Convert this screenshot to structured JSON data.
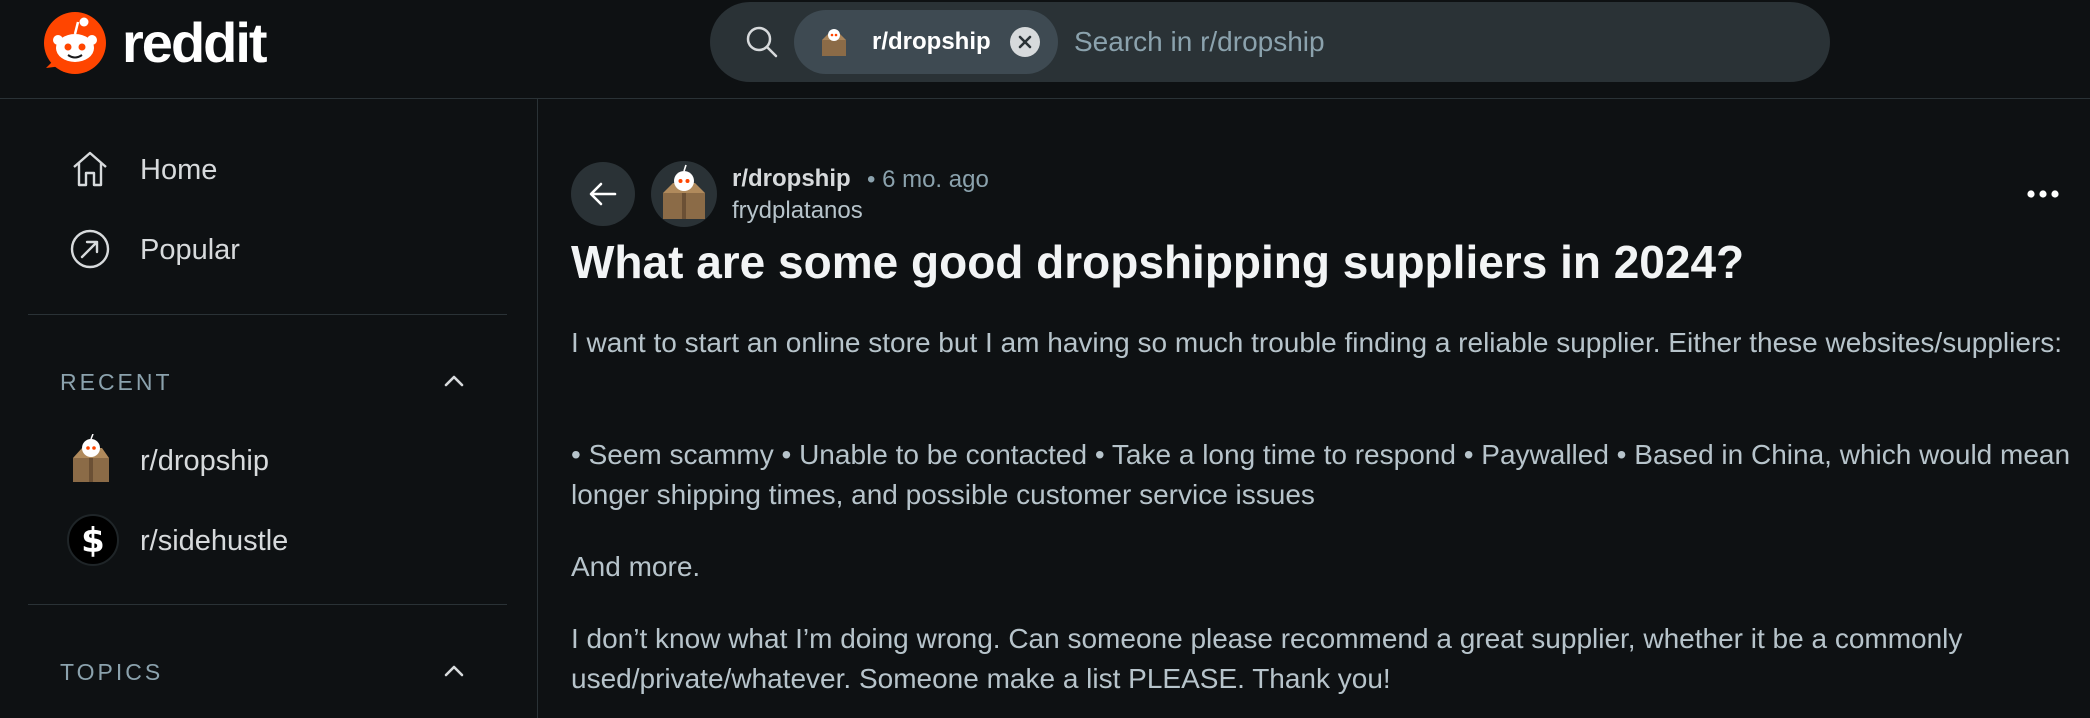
{
  "header": {
    "logo_text": "reddit",
    "search": {
      "chip_label": "r/dropship",
      "placeholder": "Search in r/dropship"
    }
  },
  "sidebar": {
    "nav": [
      {
        "label": "Home",
        "icon": "home-icon"
      },
      {
        "label": "Popular",
        "icon": "popular-icon"
      }
    ],
    "recent": {
      "heading": "RECENT",
      "items": [
        {
          "label": "r/dropship",
          "icon": "dropship-avatar"
        },
        {
          "label": "r/sidehustle",
          "icon": "sidehustle-avatar"
        }
      ]
    },
    "topics": {
      "heading": "TOPICS"
    }
  },
  "post": {
    "subreddit": "r/dropship",
    "time": "• 6 mo. ago",
    "author": "frydplatanos",
    "title": "What are some good dropshipping suppliers in 2024?",
    "paragraphs": [
      "I want to start an online store but I am having so much trouble finding a reliable supplier. Either these websites/suppliers:",
      "• Seem scammy • Unable to be contacted • Take a long time to respond • Paywalled • Based in China, which would mean longer shipping times, and possible customer service issues",
      "And more.",
      "I don’t know what I’m doing wrong. Can someone please recommend a great supplier, whether it be a commonly used/private/whatever. Someone make a list PLEASE. Thank you!"
    ]
  },
  "colors": {
    "background": "#0e1113",
    "surface": "#2a3236",
    "brand": "#ff4500",
    "text": "#d7dadc",
    "muted": "#8ba2ad"
  }
}
